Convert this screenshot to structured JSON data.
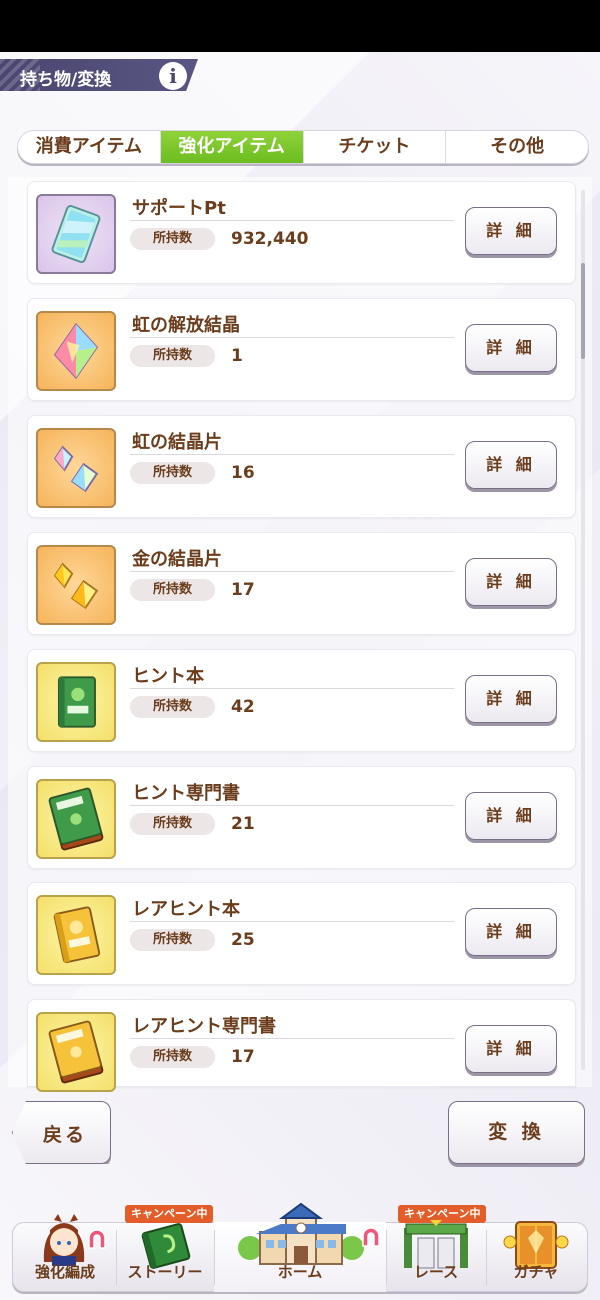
{
  "header": {
    "title": "持ち物/変換",
    "info_icon": "info-icon"
  },
  "tabs": [
    {
      "label": "消費アイテム",
      "active": false
    },
    {
      "label": "強化アイテム",
      "active": true
    },
    {
      "label": "チケット",
      "active": false
    },
    {
      "label": "その他",
      "active": false
    }
  ],
  "qty_label": "所持数",
  "detail_label": "詳 細",
  "items": [
    {
      "name": "サポートPt",
      "qty": "932,440",
      "icon": "support-pt-card-icon",
      "frame": "purple"
    },
    {
      "name": "虹の解放結晶",
      "qty": "1",
      "icon": "rainbow-crystal-icon",
      "frame": "orange"
    },
    {
      "name": "虹の結晶片",
      "qty": "16",
      "icon": "rainbow-shards-icon",
      "frame": "orange"
    },
    {
      "name": "金の結晶片",
      "qty": "17",
      "icon": "gold-shards-icon",
      "frame": "orange"
    },
    {
      "name": "ヒント本",
      "qty": "42",
      "icon": "hint-book-icon",
      "frame": "yellow"
    },
    {
      "name": "ヒント専門書",
      "qty": "21",
      "icon": "hint-textbook-icon",
      "frame": "yellow"
    },
    {
      "name": "レアヒント本",
      "qty": "25",
      "icon": "rare-hint-book-icon",
      "frame": "yellow"
    },
    {
      "name": "レアヒント専門書",
      "qty": "17",
      "icon": "rare-hint-textbook-icon",
      "frame": "yellow"
    }
  ],
  "actions": {
    "back_label": "戻る",
    "convert_label": "変 換"
  },
  "nav": {
    "campaign_label": "キャンペーン中",
    "items": [
      {
        "label": "強化編成",
        "icon": "character-icon"
      },
      {
        "label": "ストーリー",
        "icon": "story-book-icon"
      },
      {
        "label": "ホーム",
        "icon": "school-building-icon"
      },
      {
        "label": "レース",
        "icon": "race-gate-icon"
      },
      {
        "label": "ガチャ",
        "icon": "gacha-door-icon"
      }
    ]
  },
  "colors": {
    "brown_text": "#6b3d1c",
    "active_tab": "#7ac72a",
    "header_bg": "#4a4670",
    "campaign_badge": "#e35d2a"
  }
}
